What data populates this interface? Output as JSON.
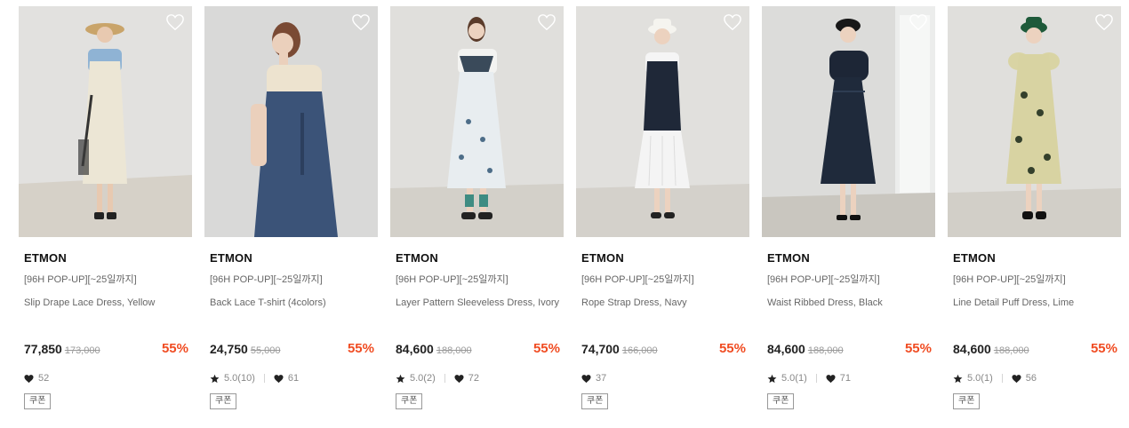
{
  "colors": {
    "discount": "#f04c22",
    "text_main": "#222222",
    "text_muted": "#666666"
  },
  "icons": {
    "wishlist": "heart-outline-icon",
    "rating": "star-icon",
    "likes": "heart-icon"
  },
  "products": [
    {
      "brand": "ETMON",
      "tag": "[96H POP-UP][~25일까지]",
      "name": "Slip Drape Lace Dress, Yellow",
      "price": "77,850",
      "original_price": "173,000",
      "discount": "55%",
      "rating": null,
      "likes": "52",
      "coupon": "쿠폰"
    },
    {
      "brand": "ETMON",
      "tag": "[96H POP-UP][~25일까지]",
      "name": "Back Lace T-shirt (4colors)",
      "price": "24,750",
      "original_price": "55,000",
      "discount": "55%",
      "rating": "5.0(10)",
      "likes": "61",
      "coupon": "쿠폰"
    },
    {
      "brand": "ETMON",
      "tag": "[96H POP-UP][~25일까지]",
      "name": "Layer Pattern Sleeveless Dress, Ivory",
      "price": "84,600",
      "original_price": "188,000",
      "discount": "55%",
      "rating": "5.0(2)",
      "likes": "72",
      "coupon": "쿠폰"
    },
    {
      "brand": "ETMON",
      "tag": "[96H POP-UP][~25일까지]",
      "name": "Rope Strap Dress, Navy",
      "price": "74,700",
      "original_price": "166,000",
      "discount": "55%",
      "rating": null,
      "likes": "37",
      "coupon": "쿠폰"
    },
    {
      "brand": "ETMON",
      "tag": "[96H POP-UP][~25일까지]",
      "name": "Waist Ribbed Dress, Black",
      "price": "84,600",
      "original_price": "188,000",
      "discount": "55%",
      "rating": "5.0(1)",
      "likes": "71",
      "coupon": "쿠폰"
    },
    {
      "brand": "ETMON",
      "tag": "[96H POP-UP][~25일까지]",
      "name": "Line Detail Puff Dress, Lime",
      "price": "84,600",
      "original_price": "188,000",
      "discount": "55%",
      "rating": "5.0(1)",
      "likes": "56",
      "coupon": "쿠폰"
    }
  ]
}
